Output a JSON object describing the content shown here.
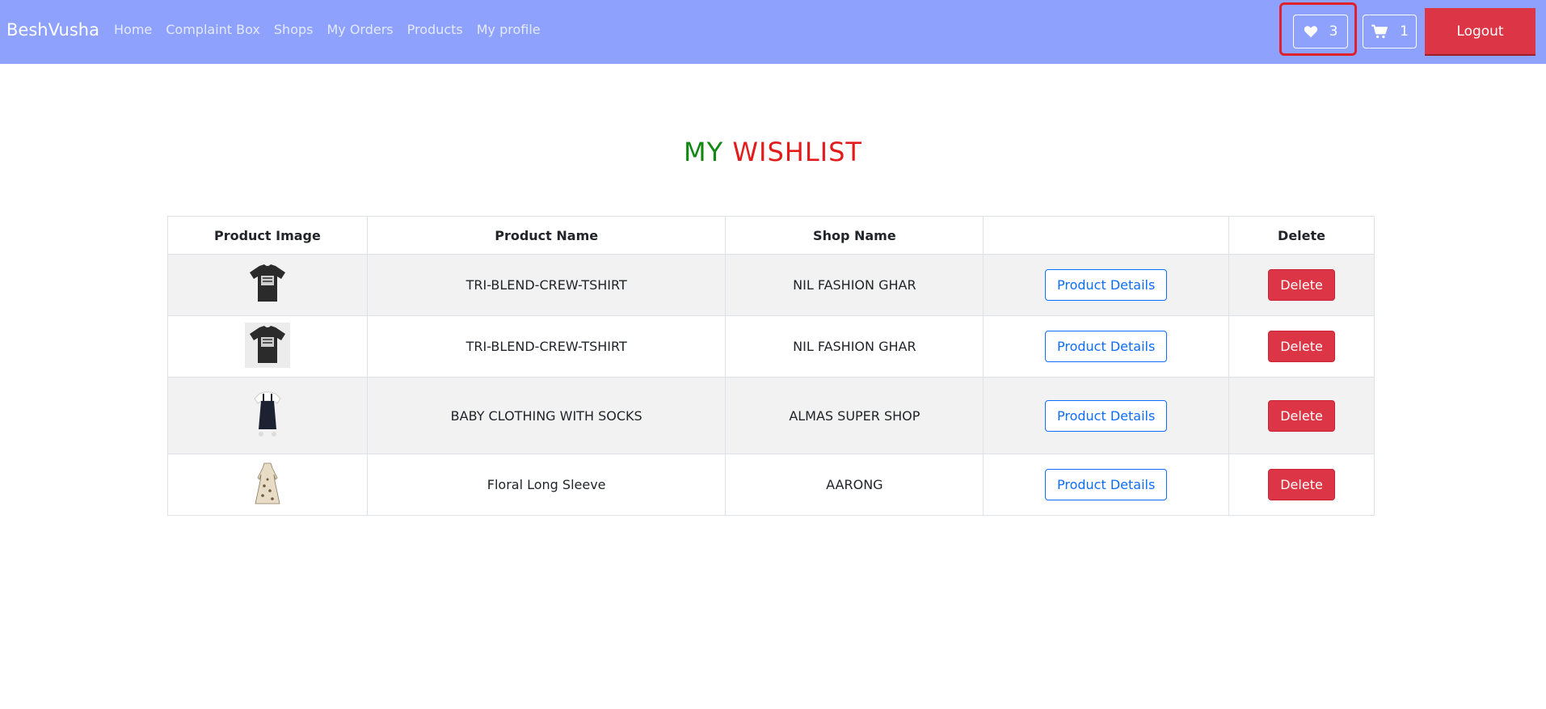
{
  "navbar": {
    "brand": "BeshVusha",
    "links": [
      "Home",
      "Complaint Box",
      "Shops",
      "My Orders",
      "Products",
      "My profile"
    ],
    "wishlist_icon": "heart-icon",
    "wishlist_count": "3",
    "cart_icon": "shopping-cart-icon",
    "cart_count": "1",
    "logout_label": "Logout",
    "background_color": "#8ea2fd"
  },
  "page": {
    "title_part1": "MY",
    "title_part2": "WISHLIST",
    "title_part1_color": "#118811",
    "title_part2_color": "#e31b1b"
  },
  "table": {
    "headers": [
      "Product Image",
      "Product Name",
      "Shop Name",
      "",
      "Delete"
    ],
    "rows": [
      {
        "image": "black-tshirt-image",
        "product_name": "TRI-BLEND-CREW-TSHIRT",
        "shop_name": "NIL FASHION GHAR",
        "details_label": "Product Details",
        "delete_label": "Delete"
      },
      {
        "image": "black-tshirt-image",
        "product_name": "TRI-BLEND-CREW-TSHIRT",
        "shop_name": "NIL FASHION GHAR",
        "details_label": "Product Details",
        "delete_label": "Delete"
      },
      {
        "image": "baby-dress-image",
        "product_name": "BABY CLOTHING WITH SOCKS",
        "shop_name": "ALMAS SUPER SHOP",
        "details_label": "Product Details",
        "delete_label": "Delete"
      },
      {
        "image": "floral-dress-image",
        "product_name": "Floral Long Sleeve",
        "shop_name": "AARONG",
        "details_label": "Product Details",
        "delete_label": "Delete"
      }
    ]
  },
  "colors": {
    "danger": "#dc3545",
    "primary": "#0d6efd",
    "annotation": "#e0202d"
  }
}
